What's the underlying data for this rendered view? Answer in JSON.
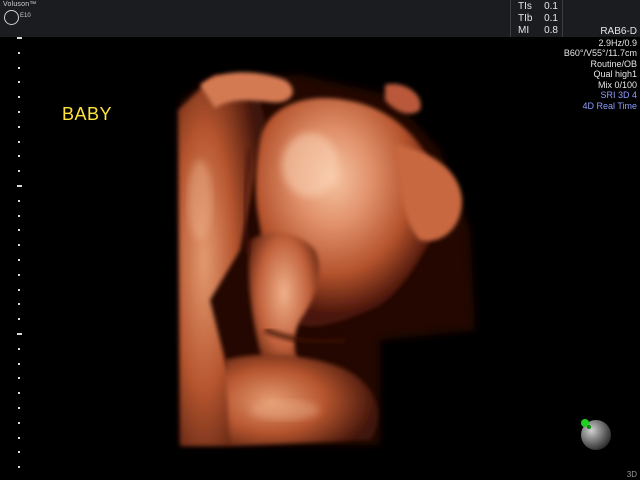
{
  "header": {
    "brand": "Voluson™",
    "model": "E10",
    "logo_text": "GE"
  },
  "safety": {
    "tis_label": "TIs",
    "tis_value": "0.1",
    "tib_label": "TIb",
    "tib_value": "0.1",
    "mi_label": "MI",
    "mi_value": "0.8"
  },
  "params": {
    "probe": "RAB6-D",
    "freq": "2.9Hz/0.9",
    "angles": "B60°/V55°/11.7cm",
    "preset": "Routine/OB",
    "quality": "Qual high1",
    "mix": "Mix 0/100",
    "sri": "SRI 3D 4",
    "mode": "4D Real Time"
  },
  "annotation": "BABY",
  "mode_tag": "3D",
  "colors": {
    "annotation": "#ffe23a",
    "mode_text": "#8f9dff",
    "skin_light": "#f2b48f",
    "skin_mid": "#c9643a",
    "skin_dark": "#5a1a0c"
  },
  "image": "4D surface render of fetal face in profile, hand near chin"
}
